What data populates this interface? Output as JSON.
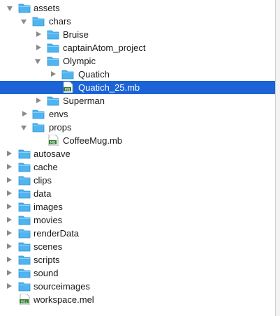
{
  "tree": {
    "rows": [
      {
        "label": "assets",
        "icon": "folder-icon",
        "expand": "down"
      },
      {
        "label": "chars",
        "icon": "folder-icon",
        "expand": "down"
      },
      {
        "label": "Bruise",
        "icon": "folder-icon",
        "expand": "right"
      },
      {
        "label": "captainAtom_project",
        "icon": "folder-icon",
        "expand": "right"
      },
      {
        "label": "Olympic",
        "icon": "folder-icon",
        "expand": "down"
      },
      {
        "label": "Quatich",
        "icon": "folder-icon",
        "expand": "right"
      },
      {
        "label": "Quatich_25.mb",
        "icon": "mb-file-icon",
        "expand": "none",
        "selected": true
      },
      {
        "label": "Superman",
        "icon": "folder-icon",
        "expand": "right"
      },
      {
        "label": "envs",
        "icon": "folder-icon",
        "expand": "right"
      },
      {
        "label": "props",
        "icon": "folder-icon",
        "expand": "down"
      },
      {
        "label": "CoffeeMug.mb",
        "icon": "mb-file-icon",
        "expand": "none"
      },
      {
        "label": "autosave",
        "icon": "folder-icon",
        "expand": "right"
      },
      {
        "label": "cache",
        "icon": "folder-icon",
        "expand": "right"
      },
      {
        "label": "clips",
        "icon": "folder-icon",
        "expand": "right"
      },
      {
        "label": "data",
        "icon": "folder-icon",
        "expand": "right"
      },
      {
        "label": "images",
        "icon": "folder-icon",
        "expand": "right"
      },
      {
        "label": "movies",
        "icon": "folder-icon",
        "expand": "right"
      },
      {
        "label": "renderData",
        "icon": "folder-icon",
        "expand": "right"
      },
      {
        "label": "scenes",
        "icon": "folder-icon",
        "expand": "right"
      },
      {
        "label": "scripts",
        "icon": "folder-icon",
        "expand": "right"
      },
      {
        "label": "sound",
        "icon": "folder-icon",
        "expand": "right"
      },
      {
        "label": "sourceimages",
        "icon": "folder-icon",
        "expand": "right"
      },
      {
        "label": "workspace.mel",
        "icon": "mel-file-icon",
        "expand": "none"
      }
    ],
    "file_badges": {
      "mb": "MB",
      "mel": "MEL"
    }
  },
  "colors": {
    "selection": "#1b63d6",
    "folder": "#4fb4ef",
    "file_badge": "#2e7d32"
  }
}
